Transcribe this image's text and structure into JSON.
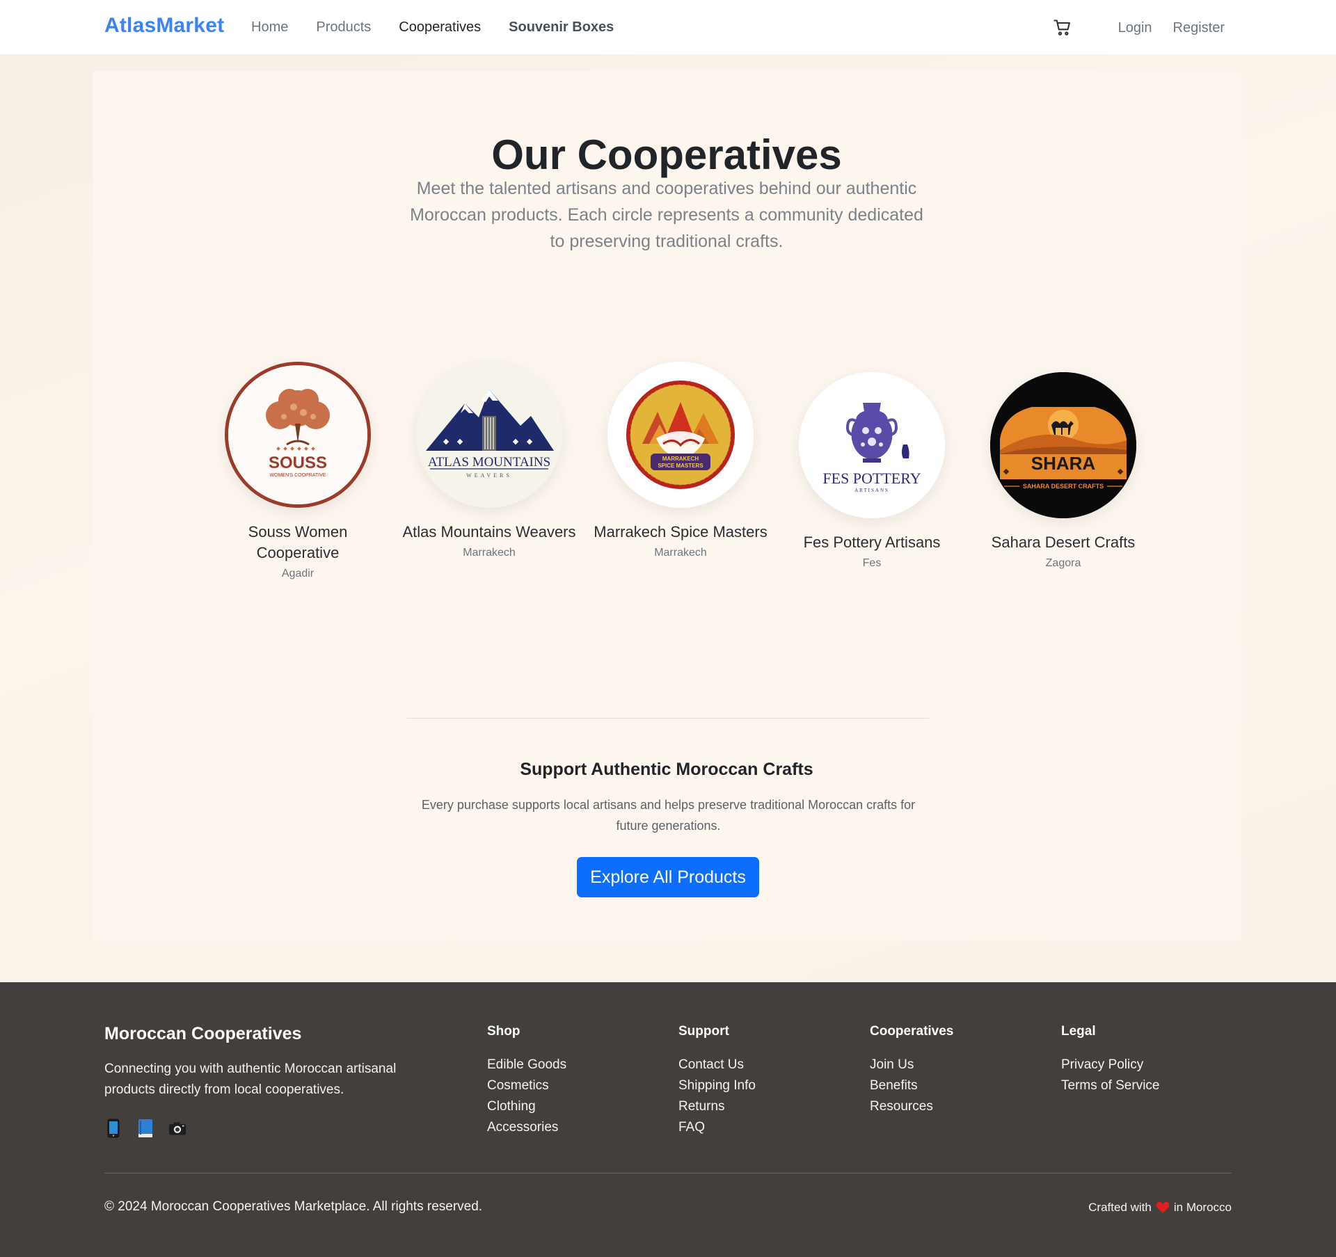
{
  "nav": {
    "brand": "AtlasMarket",
    "links": [
      "Home",
      "Products",
      "Cooperatives",
      "Souvenir Boxes"
    ],
    "login": "Login",
    "register": "Register",
    "cart_icon": "cart-icon"
  },
  "hero": {
    "title": "Our Cooperatives",
    "subtitle": "Meet the talented artisans and cooperatives behind our authentic Moroccan products. Each circle represents a community dedicated to preserving traditional crafts."
  },
  "cooperatives": [
    {
      "name": "Souss Women Cooperative",
      "city": "Agadir",
      "logo_text": "SOUSS",
      "logo_sub": "WOMEN'S COOPRATIVE",
      "accent": "#9b3b2c"
    },
    {
      "name": "Atlas Mountains Weavers",
      "city": "Marrakech",
      "logo_text": "ATLAS MOUNTAINS",
      "logo_sub": "WEAVERS",
      "accent": "#1f2a6b"
    },
    {
      "name": "Marrakech Spice Masters",
      "city": "Marrakech",
      "logo_text": "MARRAKECH",
      "logo_sub": "SPICE MASTERS",
      "accent": "#b8231c"
    },
    {
      "name": "Fes Pottery Artisans",
      "city": "Fes",
      "logo_text": "FES POTTERY",
      "logo_sub": "ARTISANS",
      "accent": "#2e2a7a"
    },
    {
      "name": "Sahara Desert Crafts",
      "city": "Zagora",
      "logo_text": "SHARA",
      "logo_sub": "SAHARA DESERT CRAFTS",
      "accent": "#d9731c"
    }
  ],
  "support": {
    "title": "Support Authentic Moroccan Crafts",
    "text": "Every purchase supports local artisans and helps preserve traditional Moroccan crafts for future generations.",
    "cta": "Explore All Products"
  },
  "footer": {
    "brand_title": "Moroccan Cooperatives",
    "brand_text": "Connecting you with authentic Moroccan artisanal products directly from local cooperatives.",
    "social_icons": [
      "phone-icon",
      "book-icon",
      "camera-icon"
    ],
    "columns": [
      {
        "title": "Shop",
        "items": [
          "Edible Goods",
          "Cosmetics",
          "Clothing",
          "Accessories"
        ]
      },
      {
        "title": "Support",
        "items": [
          "Contact Us",
          "Shipping Info",
          "Returns",
          "FAQ"
        ]
      },
      {
        "title": "Cooperatives",
        "items": [
          "Join Us",
          "Benefits",
          "Resources"
        ]
      },
      {
        "title": "Legal",
        "items": [
          "Privacy Policy",
          "Terms of Service"
        ]
      }
    ],
    "copyright": "© 2024 Moroccan Cooperatives Marketplace. All rights reserved.",
    "crafted_prefix": "Crafted with",
    "crafted_suffix": "in Morocco"
  },
  "colors": {
    "brand": "#3b82f6",
    "cta": "#0d6efd",
    "footer_bg": "#423f3c",
    "heart": "#e0201b"
  }
}
